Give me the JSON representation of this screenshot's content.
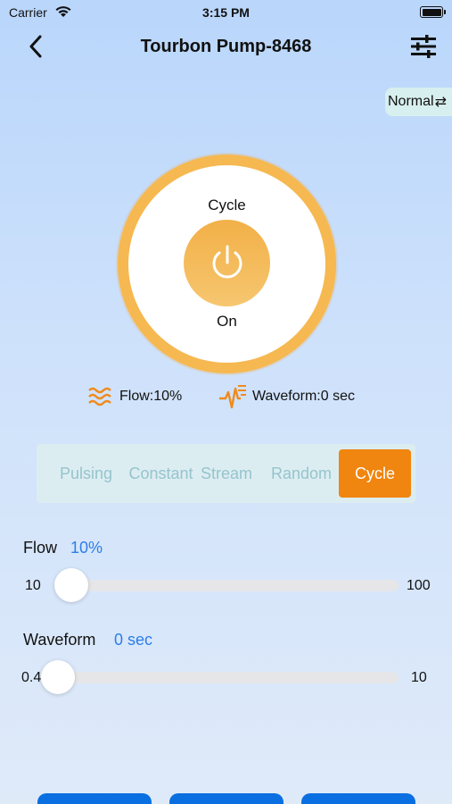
{
  "status_bar": {
    "carrier": "Carrier",
    "time": "3:15 PM"
  },
  "header": {
    "title": "Tourbon Pump-8468"
  },
  "mode_toggle": {
    "label": "Normal",
    "icon": "swap-arrows-icon"
  },
  "pump": {
    "mode_label": "Cycle",
    "state_label": "On",
    "ring_color": "#f6b850",
    "button_color": "#f2b048"
  },
  "info": {
    "flow_text": "Flow:10%",
    "waveform_text": "Waveform:0 sec"
  },
  "tabs": [
    {
      "label": "Pulsing",
      "active": false
    },
    {
      "label": "Constant",
      "active": false
    },
    {
      "label": "Stream",
      "active": false
    },
    {
      "label": "Random",
      "active": false
    },
    {
      "label": "Cycle",
      "active": true
    }
  ],
  "flow_slider": {
    "label": "Flow",
    "value_text": "10%",
    "min": "10",
    "max": "100",
    "value": 10
  },
  "waveform_slider": {
    "label": "Waveform",
    "value_text": "0 sec",
    "min": "0.4",
    "max": "10",
    "value": 0.4
  },
  "colors": {
    "accent": "#f0850f",
    "value_blue": "#2c7ee8",
    "button_blue": "#0a6fe0"
  }
}
